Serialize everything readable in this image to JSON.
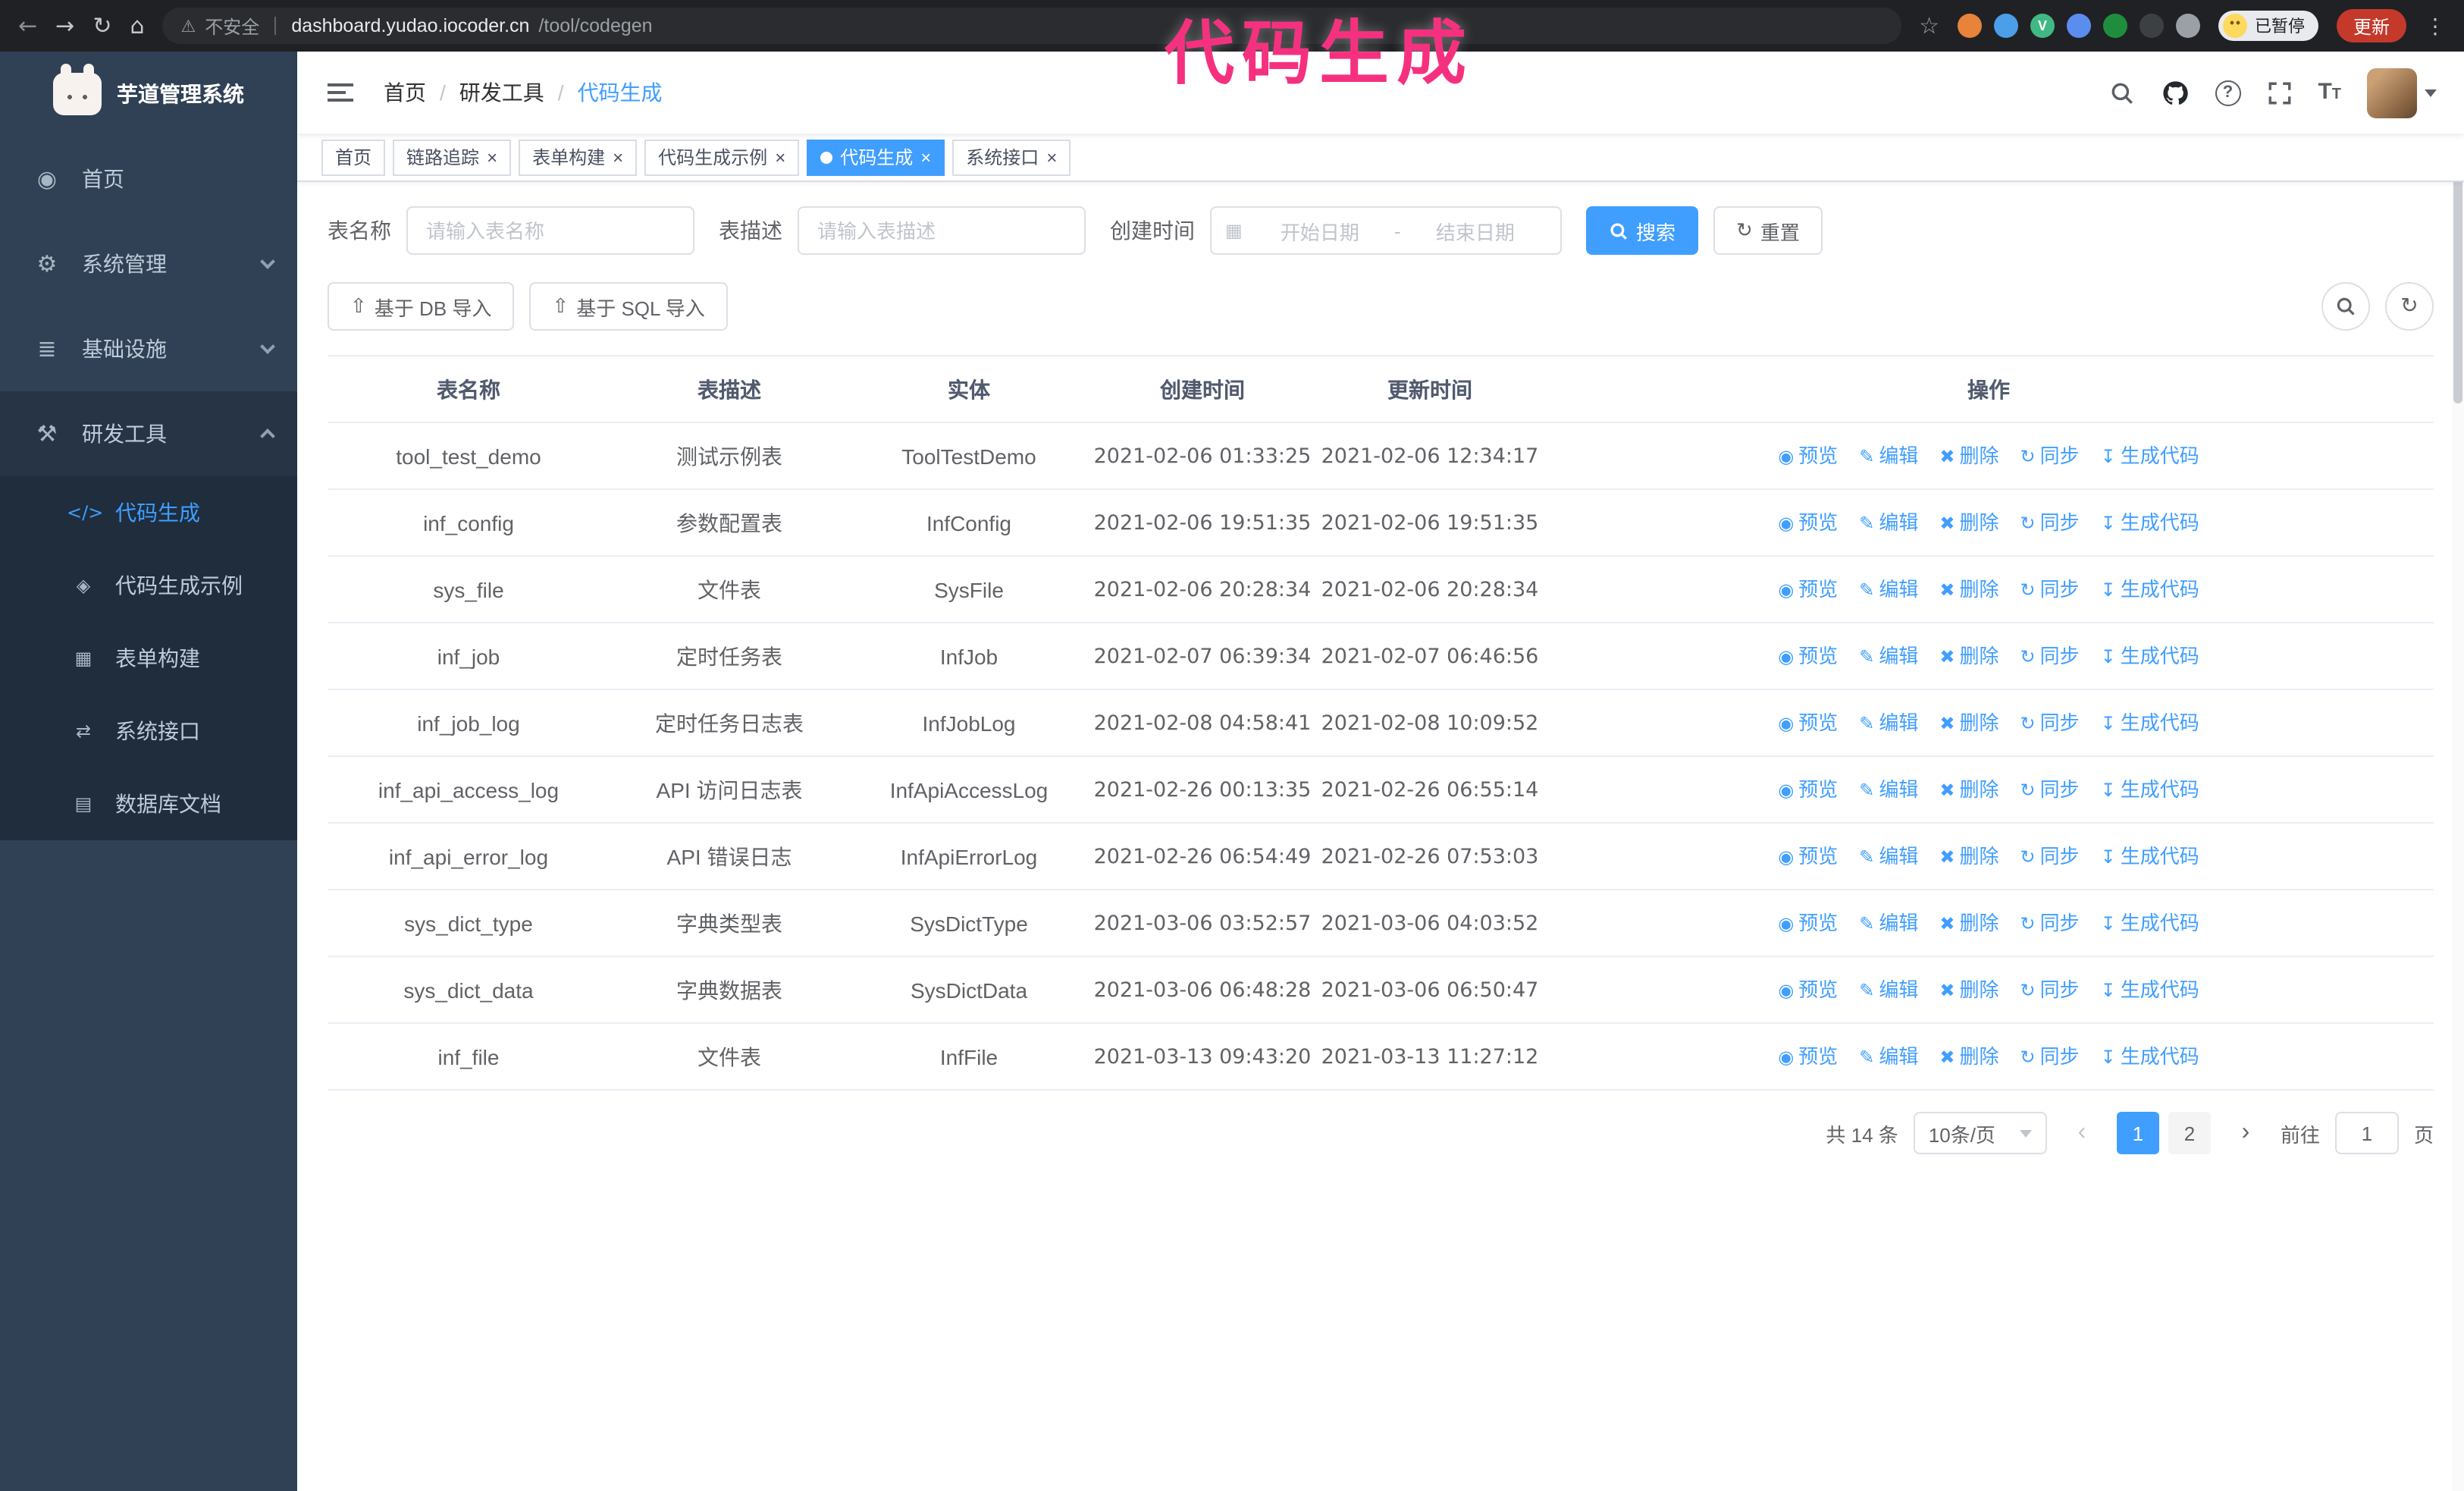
{
  "annotation": {
    "text": "代码生成",
    "color": "#f5317f"
  },
  "icons": {
    "back": "←",
    "forward": "→",
    "reload": "↻",
    "home": "⌂",
    "star": "☆",
    "warning": "⚠",
    "menu_dots": "⋮",
    "calendar": "▦",
    "upload": "⇧",
    "refresh": "↻",
    "close": "×"
  },
  "browser": {
    "insecure_label": "不安全",
    "url_host": "dashboard.yudao.iocoder.cn",
    "url_path": "/tool/codegen",
    "paused_badge": "已暂停",
    "update_button": "更新",
    "extensions": [
      {
        "name": "orange-fox-extension-icon",
        "color": "#e8833a",
        "glyph": ""
      },
      {
        "name": "blue-drop-extension-icon",
        "color": "#4a9fe8",
        "glyph": ""
      },
      {
        "name": "vue-devtools-extension-icon",
        "color": "#41b883",
        "glyph": "V"
      },
      {
        "name": "people-extension-icon",
        "color": "#5b8def",
        "glyph": ""
      },
      {
        "name": "green-tool-extension-icon",
        "color": "#1e8e3e",
        "glyph": ""
      },
      {
        "name": "dark-paw-extension-icon",
        "color": "#3c4043",
        "glyph": ""
      },
      {
        "name": "puzzle-extension-icon",
        "color": "#9aa0a6",
        "glyph": ""
      }
    ]
  },
  "navbar": {
    "breadcrumb": [
      "首页",
      "研发工具",
      "代码生成"
    ],
    "breadcrumb_separator": "/"
  },
  "sidebar": {
    "title": "芋道管理系统",
    "menu": [
      {
        "id": "home",
        "label": "首页",
        "icon": "dashboard-icon",
        "glyph": "◉"
      },
      {
        "id": "system-mgmt",
        "label": "系统管理",
        "icon": "gear-icon",
        "glyph": "⚙",
        "chevron": "down"
      },
      {
        "id": "infrastructure",
        "label": "基础设施",
        "icon": "infrastructure-icon",
        "glyph": "≣",
        "chevron": "down"
      },
      {
        "id": "dev-tools",
        "label": "研发工具",
        "icon": "dev-tools-icon",
        "glyph": "⚒",
        "chevron": "up",
        "expanded": true,
        "children": [
          {
            "id": "codegen",
            "label": "代码生成",
            "icon": "code-icon",
            "glyph": "</>",
            "active": true
          },
          {
            "id": "codegen-example",
            "label": "代码生成示例",
            "icon": "example-icon",
            "glyph": "◈"
          },
          {
            "id": "form-builder",
            "label": "表单构建",
            "icon": "form-builder-icon",
            "glyph": "▦"
          },
          {
            "id": "system-api",
            "label": "系统接口",
            "icon": "api-icon",
            "glyph": "⇄"
          },
          {
            "id": "db-doc",
            "label": "数据库文档",
            "icon": "db-doc-icon",
            "glyph": "▤"
          }
        ]
      }
    ]
  },
  "tabs": [
    {
      "id": "home",
      "label": "首页",
      "closable": false
    },
    {
      "id": "tracer",
      "label": "链路追踪",
      "closable": true
    },
    {
      "id": "form-builder",
      "label": "表单构建",
      "closable": true
    },
    {
      "id": "codegen-example",
      "label": "代码生成示例",
      "closable": true
    },
    {
      "id": "codegen",
      "label": "代码生成",
      "closable": true,
      "active": true
    },
    {
      "id": "system-api",
      "label": "系统接口",
      "closable": true
    }
  ],
  "filters": {
    "name_label": "表名称",
    "name_placeholder": "请输入表名称",
    "desc_label": "表描述",
    "desc_placeholder": "请输入表描述",
    "time_label": "创建时间",
    "start_placeholder": "开始日期",
    "range_separator": "-",
    "end_placeholder": "结束日期",
    "search_label": "搜索",
    "reset_label": "重置"
  },
  "toolbar": {
    "db_import": "基于 DB 导入",
    "sql_import": "基于 SQL 导入"
  },
  "table": {
    "headers": [
      "表名称",
      "表描述",
      "实体",
      "创建时间",
      "更新时间",
      "操作"
    ],
    "action_labels": [
      "预览",
      "编辑",
      "删除",
      "同步",
      "生成代码"
    ],
    "action_ids": [
      "preview",
      "edit",
      "delete",
      "sync",
      "generate-code"
    ],
    "action_icons": [
      "preview-eye-icon",
      "edit-pencil-icon",
      "delete-trash-icon",
      "sync-icon",
      "generate-code-download-icon"
    ],
    "action_glyphs": [
      "◉",
      "✎",
      "✖",
      "↻",
      "↧"
    ],
    "rows": [
      {
        "name": "tool_test_demo",
        "desc": "测试示例表",
        "entity": "ToolTestDemo",
        "created": "2021-02-06 01:33:25",
        "updated": "2021-02-06 12:34:17"
      },
      {
        "name": "inf_config",
        "desc": "参数配置表",
        "entity": "InfConfig",
        "created": "2021-02-06 19:51:35",
        "updated": "2021-02-06 19:51:35"
      },
      {
        "name": "sys_file",
        "desc": "文件表",
        "entity": "SysFile",
        "created": "2021-02-06 20:28:34",
        "updated": "2021-02-06 20:28:34"
      },
      {
        "name": "inf_job",
        "desc": "定时任务表",
        "entity": "InfJob",
        "created": "2021-02-07 06:39:34",
        "updated": "2021-02-07 06:46:56"
      },
      {
        "name": "inf_job_log",
        "desc": "定时任务日志表",
        "entity": "InfJobLog",
        "created": "2021-02-08 04:58:41",
        "updated": "2021-02-08 10:09:52"
      },
      {
        "name": "inf_api_access_log",
        "desc": "API 访问日志表",
        "entity": "InfApiAccessLog",
        "created": "2021-02-26 00:13:35",
        "updated": "2021-02-26 06:55:14"
      },
      {
        "name": "inf_api_error_log",
        "desc": "API 错误日志",
        "entity": "InfApiErrorLog",
        "created": "2021-02-26 06:54:49",
        "updated": "2021-02-26 07:53:03"
      },
      {
        "name": "sys_dict_type",
        "desc": "字典类型表",
        "entity": "SysDictType",
        "created": "2021-03-06 03:52:57",
        "updated": "2021-03-06 04:03:52"
      },
      {
        "name": "sys_dict_data",
        "desc": "字典数据表",
        "entity": "SysDictData",
        "created": "2021-03-06 06:48:28",
        "updated": "2021-03-06 06:50:47"
      },
      {
        "name": "inf_file",
        "desc": "文件表",
        "entity": "InfFile",
        "created": "2021-03-13 09:43:20",
        "updated": "2021-03-13 11:27:12"
      }
    ]
  },
  "pagination": {
    "total_text": "共 14 条",
    "page_size": "10条/页",
    "pages": [
      "1",
      "2"
    ],
    "active_page": "1",
    "goto_label": "前往",
    "goto_value": "1",
    "goto_unit": "页"
  },
  "colors": {
    "primary": "#409eff",
    "sidebar_bg": "#304156",
    "submenu_bg": "#1f2d3d",
    "annotation": "#f5317f"
  }
}
